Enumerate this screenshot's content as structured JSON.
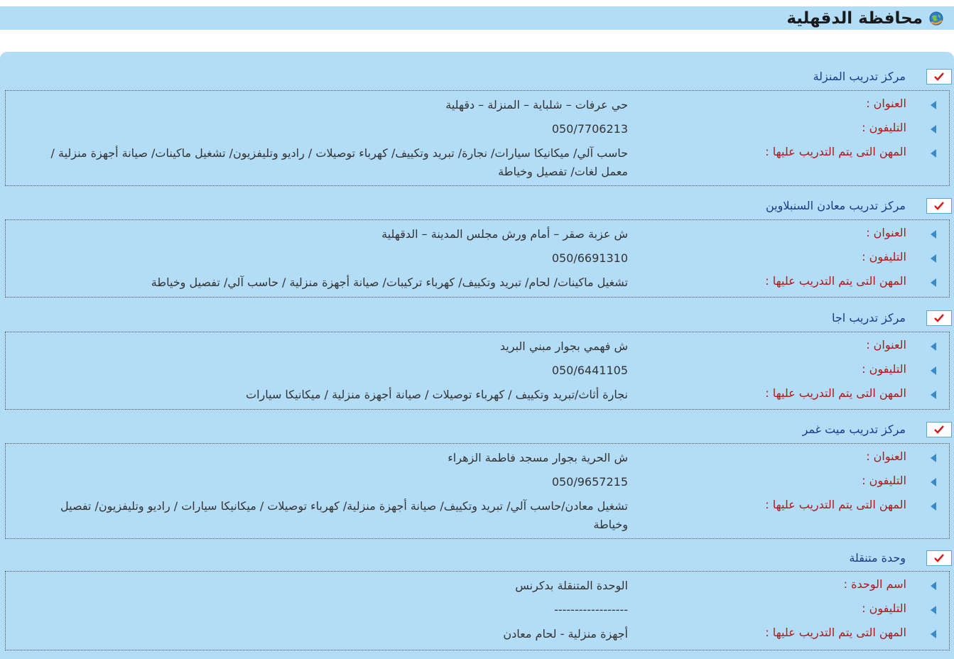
{
  "page": {
    "title": "محافظة الدقهلية"
  },
  "labels": {
    "address": "العنوان :",
    "phone": "التليفون :",
    "professions": "المهن التى يتم التدريب عليها :",
    "unit_name": "اسم الوحدة :"
  },
  "centers": [
    {
      "name": "مركز تدريب المنزلة",
      "address": "حي عرفات – شلباية – المنزلة – دقهلية",
      "phone": "050/7706213",
      "professions": "حاسب آلي/ ميكانيكا سيارات/ نجارة/ تبريد وتكييف/ كهرباء    توصيلات / راديو وتليفزيون/ تشغيل ماكينات/ صيانة أجهزة منزلية / معمل لغات/ تفصيل وخياطة"
    },
    {
      "name": "مركز تدريب معادن السنبلاوين",
      "address": "ش عزبة صقر – أمام ورش مجلس المدينة – الدقهلية",
      "phone": "050/6691310",
      "professions": "تشغيل ماكينات/ لحام/ تبريد وتكييف/ كهرباء تركيبات/ صيانة أجهزة منزلية / حاسب آلي/ تفصيل وخياطة"
    },
    {
      "name": "مركز تدريب اجا",
      "address": "ش فهمي بجوار مبني البريد",
      "phone": "050/6441105",
      "professions": "نجارة أثاث/تبريد وتكييف /  كهرباء توصيلات / صيانة أجهزة منزلية / ميكانيكا سيارات"
    },
    {
      "name": "مركز تدريب ميت غمر",
      "address": "ش الحرية بجوار مسجد فاطمة الزهراء",
      "phone": "050/9657215",
      "professions": "تشغيل معادن/حاسب آلي/ تبريد وتكييف/ صيانة أجهزة منزلية/  كهرباء    توصيلات / ميكانيكا سيارات / راديو وتليفزيون/ تفصيل وخياطة"
    }
  ],
  "mobile_unit": {
    "name": "وحدة متنقلة",
    "unit_name": "الوحدة المتنقلة بدكرنس",
    "phone": "------------------",
    "professions": "أجهزة منزلية - لحام معادن"
  },
  "colors": {
    "panel": "#b3dcf7",
    "label_red": "#b01818",
    "name_blue": "#1a3a8a",
    "check_red": "#d81b1b"
  }
}
